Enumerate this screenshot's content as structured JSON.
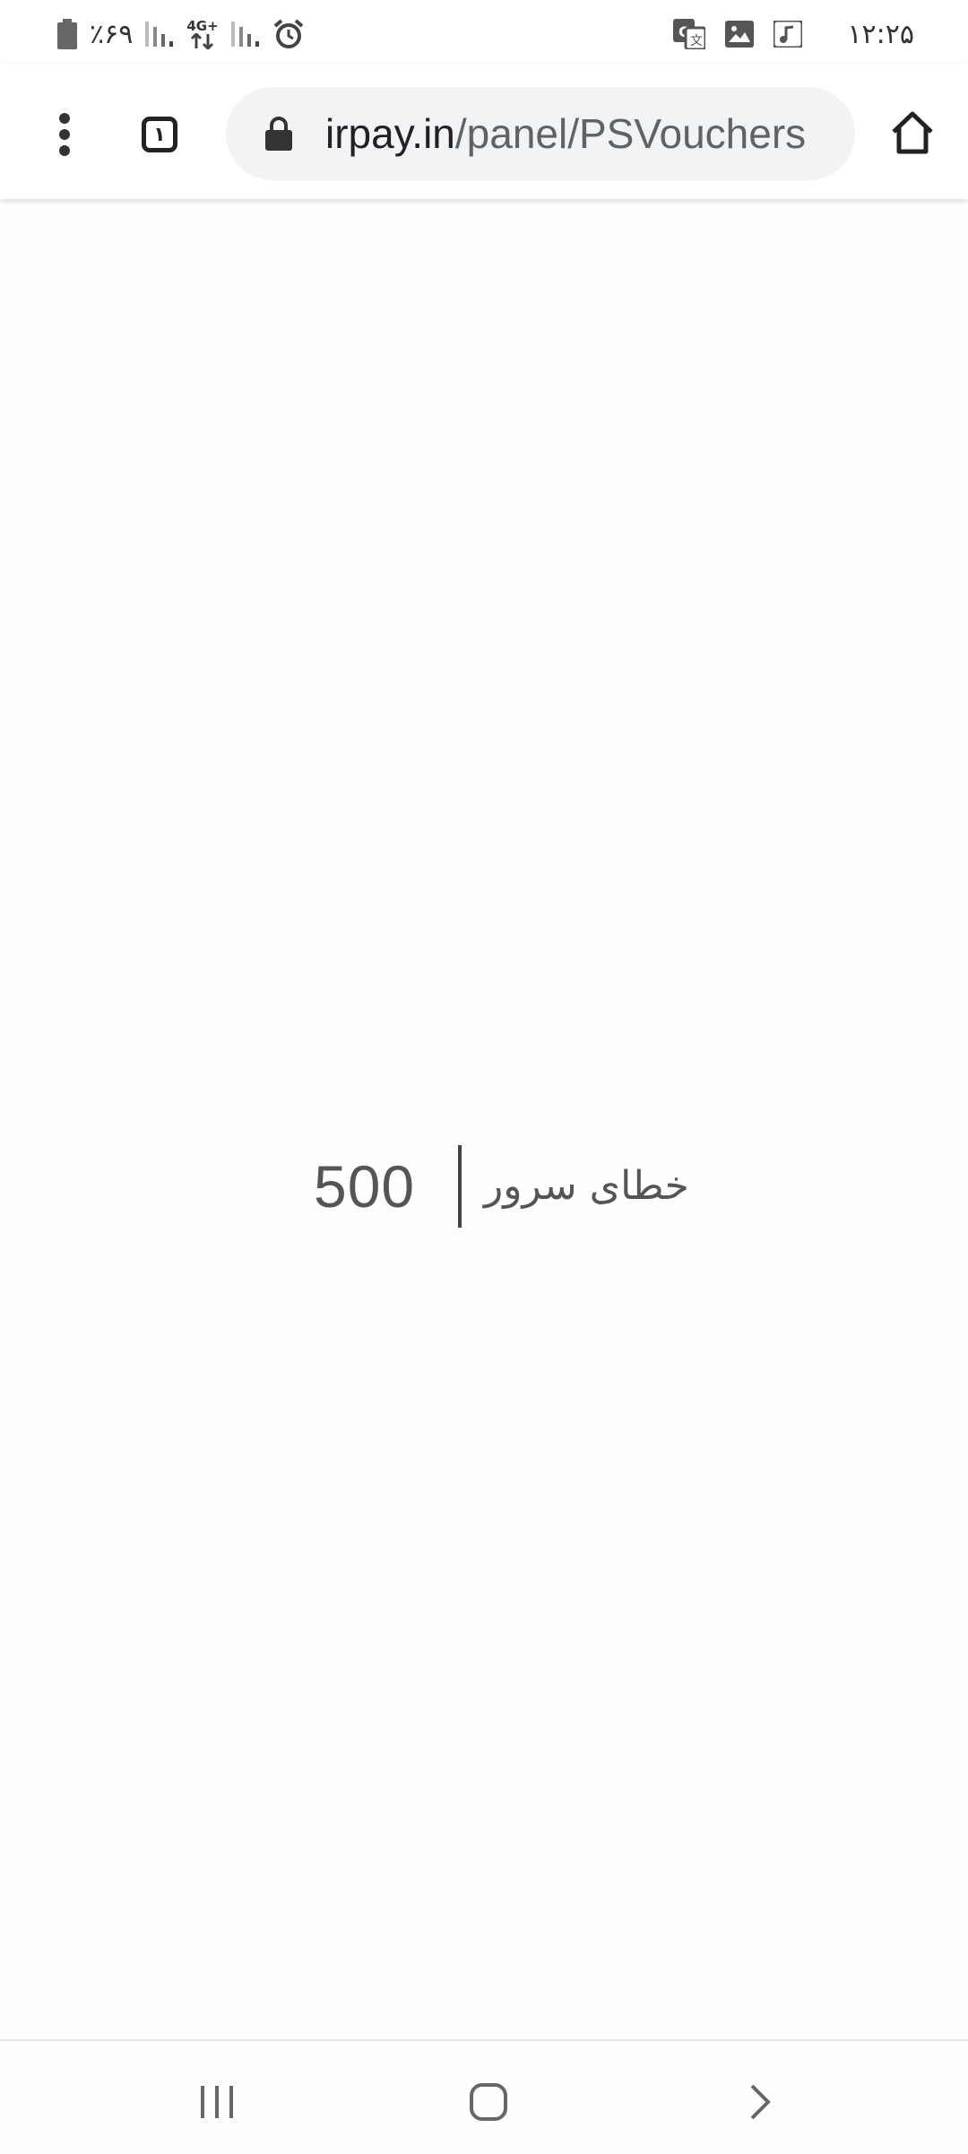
{
  "status_bar": {
    "time": "۱۲:۲۵",
    "battery_percent": "٪۶۹",
    "network_type": "4G+",
    "icons": [
      "battery-icon",
      "signal-icon",
      "data-arrows-icon",
      "signal-icon",
      "alarm-icon",
      "translate-icon",
      "gallery-icon",
      "music-icon"
    ]
  },
  "browser": {
    "url_host": "irpay.in",
    "url_path": "/panel/PSVouchers",
    "tab_count": "۱",
    "icons": [
      "menu-icon",
      "tabs-icon",
      "lock-icon",
      "home-icon"
    ]
  },
  "error": {
    "code": "500",
    "message": "خطای سرور"
  },
  "nav_bar": {
    "icons": [
      "recents-icon",
      "home-icon",
      "back-icon"
    ]
  }
}
